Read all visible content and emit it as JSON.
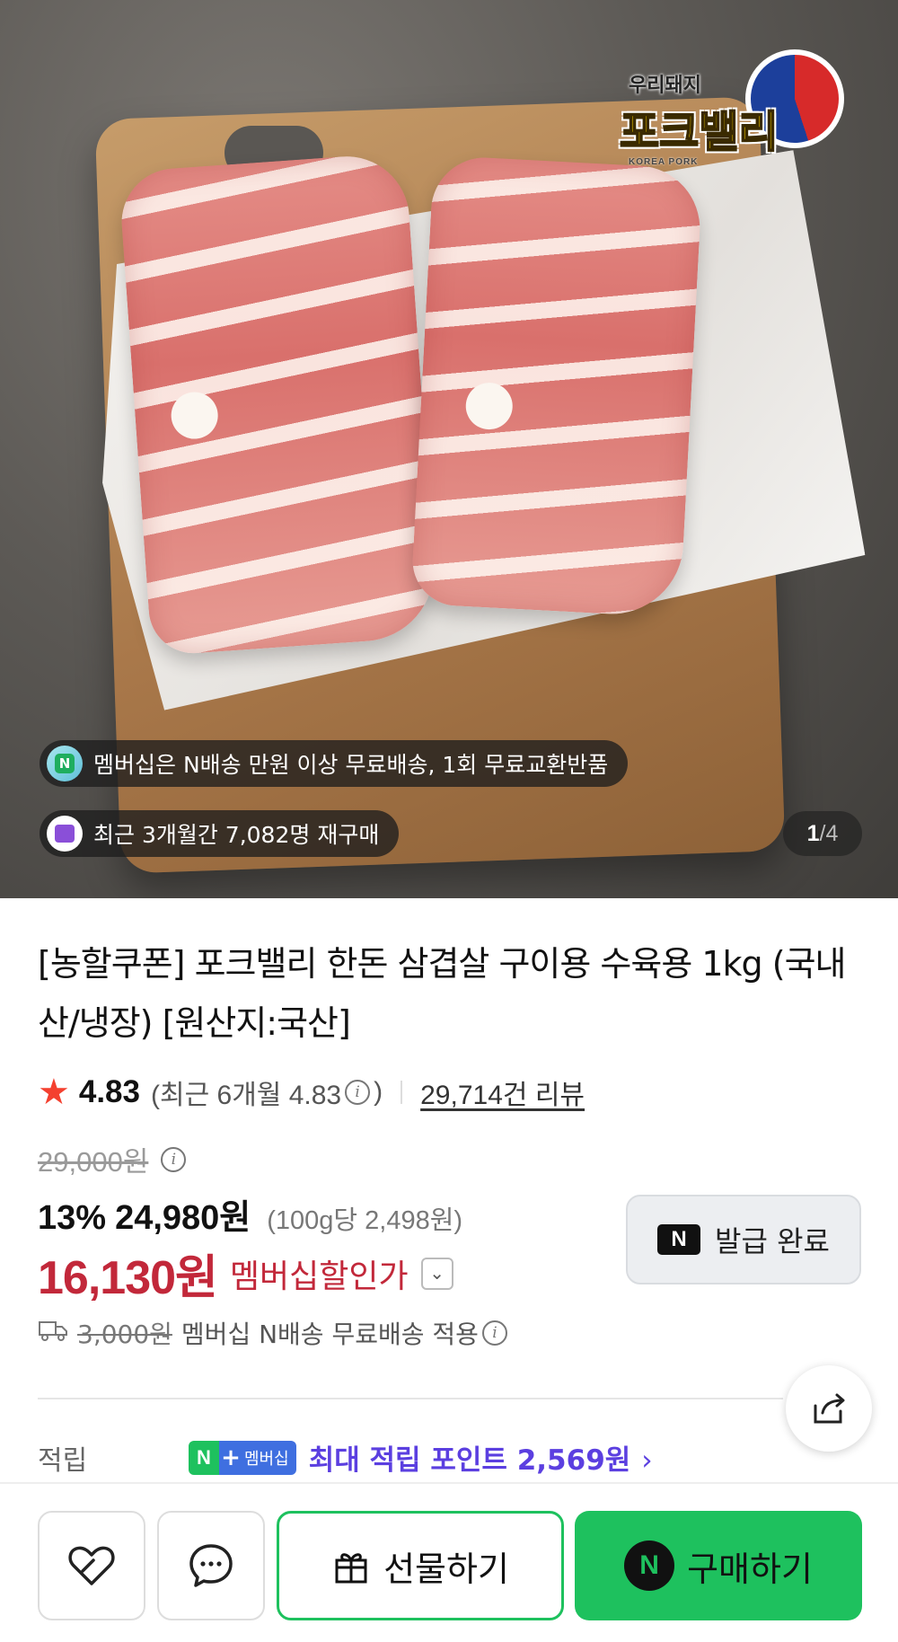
{
  "hero": {
    "logo_sub": "우리돼지",
    "logo_main": "포크밸리",
    "logo_eng": "KOREA PORK",
    "chip_membership": "멤버십은 N배송 만원 이상 무료배송, 1회 무료교환반품",
    "chip_rebuy": "최근 3개월간 7,082명 재구매",
    "page_current": "1",
    "page_total": "/4"
  },
  "product": {
    "title": "[농할쿠폰] 포크밸리 한돈 삼겹살 구이용 수육용 1kg (국내산/냉장) [원산지:국산]",
    "rating": "4.83",
    "recent_rating_prefix": "(최근 6개월 4.83",
    "recent_rating_suffix": ")",
    "review_count": "29,714건 리뷰",
    "original_price": "29,000원",
    "discount_percent": "13%",
    "sale_price": "24,980원",
    "unit_price": "(100g당 2,498원)",
    "member_price": "16,130원",
    "member_price_label": "멤버십할인가",
    "coupon_button": "발급 완료",
    "shipping_original": "3,000원",
    "shipping_text": "멤버십 N배송 무료배송 적용",
    "points_label": "적립",
    "points_badge_membership": "멤버십",
    "points_text": "최대 적립 포인트 2,569원"
  },
  "bottom_bar": {
    "gift_label": "선물하기",
    "buy_label": "구매하기"
  },
  "colors": {
    "accent_green": "#1ec15e",
    "member_red": "#c2283a",
    "points_purple": "#5b3fe0",
    "star": "#f4402f"
  }
}
